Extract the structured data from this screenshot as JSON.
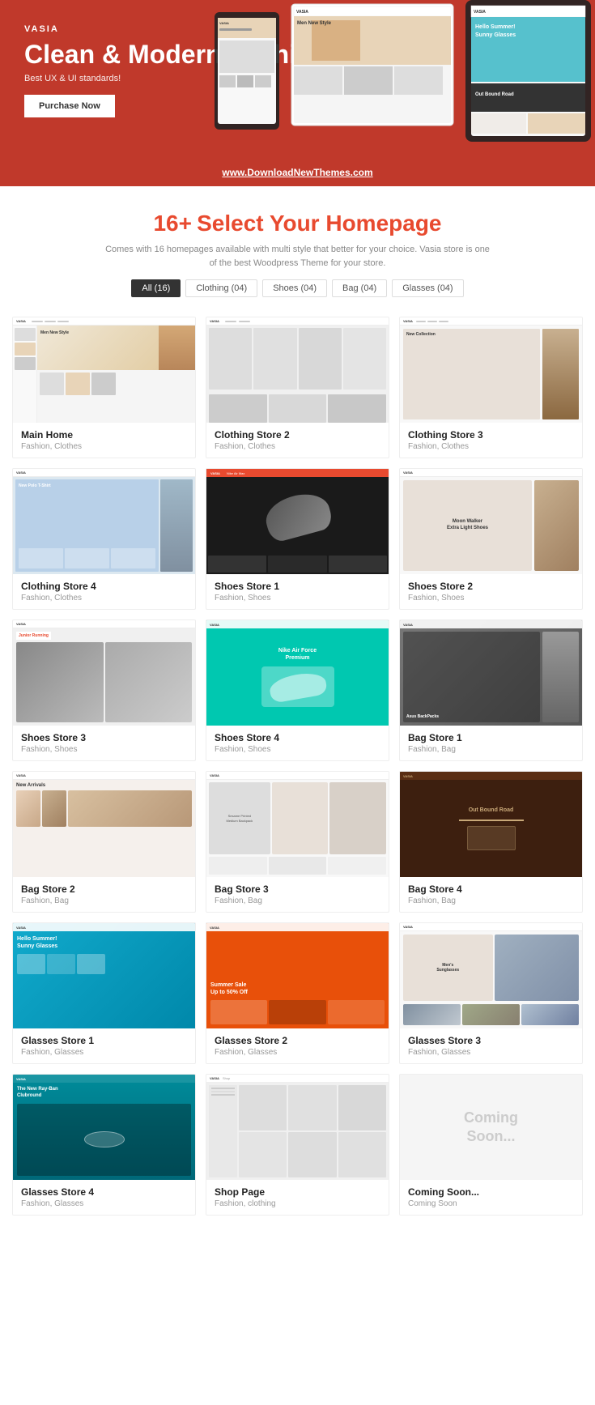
{
  "hero": {
    "brand": "VASIA",
    "title": "Clean & Modern Fashion theme!",
    "subtitle": "Best UX & UI standards!",
    "button": "Purchase Now",
    "url": "www.DownloadNewThemes.com"
  },
  "select": {
    "badge": "16+",
    "title": "Select Your Homepage",
    "description": "Comes with 16 homepages available with multi style that better for your choice. Vasia store is one of the best Woodpress Theme for your store.",
    "tabs": [
      {
        "label": "All (16)",
        "active": true
      },
      {
        "label": "Clothing (04)",
        "active": false
      },
      {
        "label": "Shoes (04)",
        "active": false
      },
      {
        "label": "Bag (04)",
        "active": false
      },
      {
        "label": "Glasses (04)",
        "active": false
      }
    ]
  },
  "items": [
    {
      "name": "Main Home",
      "tags": "Fashion, Clothes",
      "bg": "#f0ece8",
      "type": "main-home"
    },
    {
      "name": "Clothing Store 2",
      "tags": "Fashion, Clothes",
      "bg": "#f0f0f0",
      "type": "clothing2"
    },
    {
      "name": "Clothing Store 3",
      "tags": "Fashion, Clothes",
      "bg": "#f5f5f5",
      "type": "clothing3"
    },
    {
      "name": "Clothing Store 4",
      "tags": "Fashion, Clothes",
      "bg": "#dce8f0",
      "type": "clothing4"
    },
    {
      "name": "Shoes Store 1",
      "tags": "Fashion, Shoes",
      "bg": "#1a1a1a",
      "type": "shoes1"
    },
    {
      "name": "Shoes Store 2",
      "tags": "Fashion, Shoes",
      "bg": "#f8f8f8",
      "type": "shoes2"
    },
    {
      "name": "Shoes Store 3",
      "tags": "Fashion, Shoes",
      "bg": "#f0f0f0",
      "type": "shoes3"
    },
    {
      "name": "Shoes Store 4",
      "tags": "Fashion, Shoes",
      "bg": "#00c8b0",
      "type": "shoes4"
    },
    {
      "name": "Bag Store 1",
      "tags": "Fashion, Bag",
      "bg": "#888888",
      "type": "bag1"
    },
    {
      "name": "Bag Store 2",
      "tags": "Fashion, Bag",
      "bg": "#f5f0ec",
      "type": "bag2"
    },
    {
      "name": "Bag Store 3",
      "tags": "Fashion, Bag",
      "bg": "#f8f8f8",
      "type": "bag3"
    },
    {
      "name": "Bag Store 4",
      "tags": "Fashion, Bag",
      "bg": "#3d1f0f",
      "type": "bag4"
    },
    {
      "name": "Glasses Store 1",
      "tags": "Fashion, Glasses",
      "bg": "#11aacc",
      "type": "glasses1"
    },
    {
      "name": "Glasses Store 2",
      "tags": "Fashion, Glasses",
      "bg": "#e8500a",
      "type": "glasses2"
    },
    {
      "name": "Glasses Store 3",
      "tags": "Fashion, Glasses",
      "bg": "#f8f8f8",
      "type": "glasses3"
    },
    {
      "name": "Glasses Store 4",
      "tags": "Fashion, Glasses",
      "bg": "#008b9a",
      "type": "glasses4"
    },
    {
      "name": "Shop Page",
      "tags": "Fashion, clothing",
      "bg": "#f0f0f0",
      "type": "shop"
    },
    {
      "name": "Coming Soon...",
      "tags": "Coming Soon",
      "bg": "#f5f5f5",
      "type": "coming"
    }
  ]
}
